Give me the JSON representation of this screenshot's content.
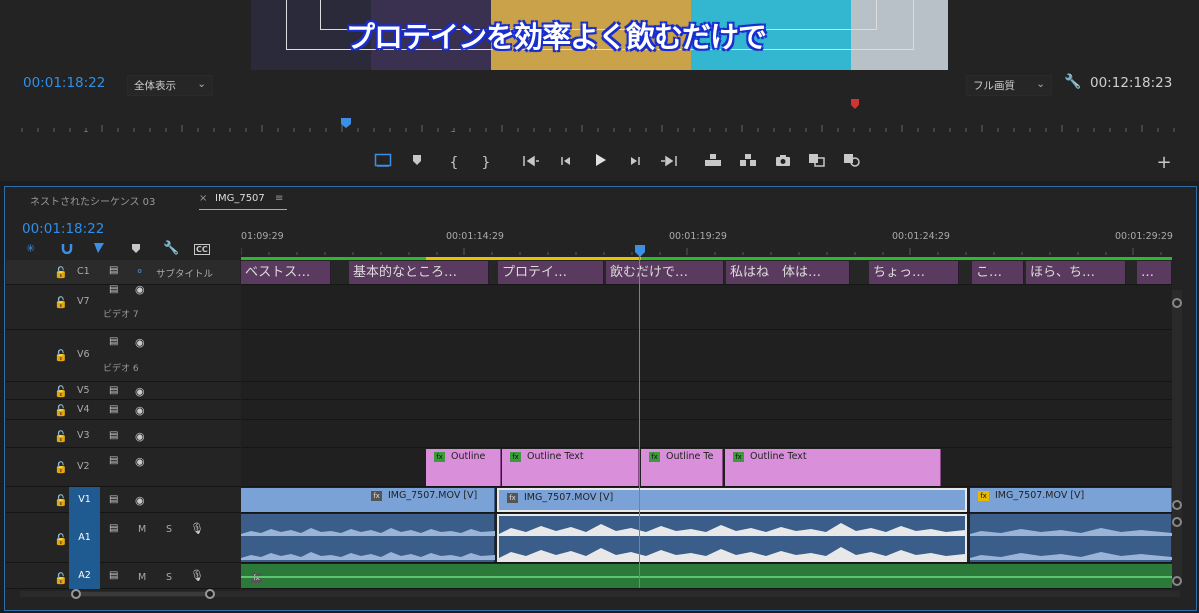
{
  "program_monitor": {
    "caption": "プロテインを効率よく飲むだけで",
    "playhead_tc": "00:01:18:22",
    "zoom_select": "全体表示",
    "quality_select": "フル画質",
    "duration_tc": "00:12:18:23",
    "chevron": "⌄",
    "controls": {
      "mark_in": "{",
      "mark_out": "}",
      "plus": "+"
    }
  },
  "timeline": {
    "tabs": [
      {
        "label": "ネストされたシーケンス 03"
      },
      {
        "label": "IMG_7507",
        "close": "×",
        "menu": "≡"
      }
    ],
    "playhead_tc": "00:01:18:22",
    "ruler_labels": [
      "01:09:29",
      "00:01:14:29",
      "00:01:19:29",
      "00:01:24:29",
      "00:01:29:29"
    ],
    "tool_cc": "CC",
    "tracks": {
      "c1": {
        "name": "C1",
        "title": "サブタイトル"
      },
      "v7": {
        "name": "V7",
        "title": "ビデオ 7"
      },
      "v6": {
        "name": "V6",
        "title": "ビデオ 6"
      },
      "v5": {
        "name": "V5"
      },
      "v4": {
        "name": "V4"
      },
      "v3": {
        "name": "V3"
      },
      "v2": {
        "name": "V2"
      },
      "v1": {
        "name": "V1",
        "target": "V1"
      },
      "a1": {
        "name": "A1",
        "target": "A1",
        "m": "M",
        "s": "S"
      },
      "a2": {
        "name": "A2",
        "target": "A2",
        "m": "M",
        "s": "S"
      }
    },
    "subtitles": [
      "ベストス…",
      "基本的なところ…",
      "プロテイ…",
      "飲むだけで…",
      "私はね　体は…",
      "ちょっ…",
      "こ…",
      "ほら、ち…",
      "…"
    ],
    "graphics": [
      "Outline",
      "Outline Text",
      "Outline Te",
      "Outline Text"
    ],
    "video_clips": [
      "IMG_7507.MOV [V]",
      "IMG_7507.MOV [V]",
      "IMG_7507.MOV [V]"
    ],
    "fx": "fx"
  }
}
